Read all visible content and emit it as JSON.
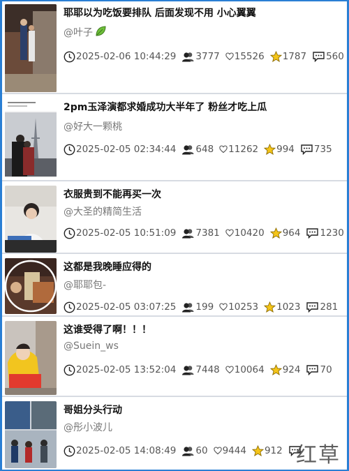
{
  "colors": {
    "frame": "#2a7fd4",
    "title": "#111111",
    "author": "#777777",
    "meta": "#555555",
    "star": "#f5c518",
    "leaf": "#6fbf3a"
  },
  "posts": [
    {
      "title": "耶耶以为吃饭要排队 后面发现不用 小心翼翼",
      "author": "@叶子",
      "author_badge": "leaf-icon",
      "time": "2025-02-06 10:44:29",
      "views": "3777",
      "likes": "15526",
      "stars": "1787",
      "comments": "560"
    },
    {
      "title": "2pm玉泽演都求婚成功大半年了 粉丝才吃上瓜",
      "author": "@好大一颗桃",
      "time": "2025-02-05 02:34:44",
      "views": "648",
      "likes": "11262",
      "stars": "994",
      "comments": "735"
    },
    {
      "title": "衣服贵到不能再买一次",
      "author": "@大圣的精简生活",
      "time": "2025-02-05 10:51:09",
      "views": "7381",
      "likes": "10420",
      "stars": "964",
      "comments": "1230"
    },
    {
      "title": "这都是我晚睡应得的",
      "author": "@耶耶包-",
      "time": "2025-02-05 03:07:25",
      "views": "199",
      "likes": "10253",
      "stars": "1023",
      "comments": "281"
    },
    {
      "title": "这谁受得了啊！！！",
      "author": "@Suein_ws",
      "time": "2025-02-05 13:52:04",
      "views": "7448",
      "likes": "10064",
      "stars": "924",
      "comments": "70"
    },
    {
      "title": "哥姐分头行动",
      "author": "@彤小波儿",
      "time": "2025-02-05 14:08:49",
      "views": "60",
      "likes": "9444",
      "stars": "912",
      "comments": ""
    }
  ],
  "watermark": "红草"
}
